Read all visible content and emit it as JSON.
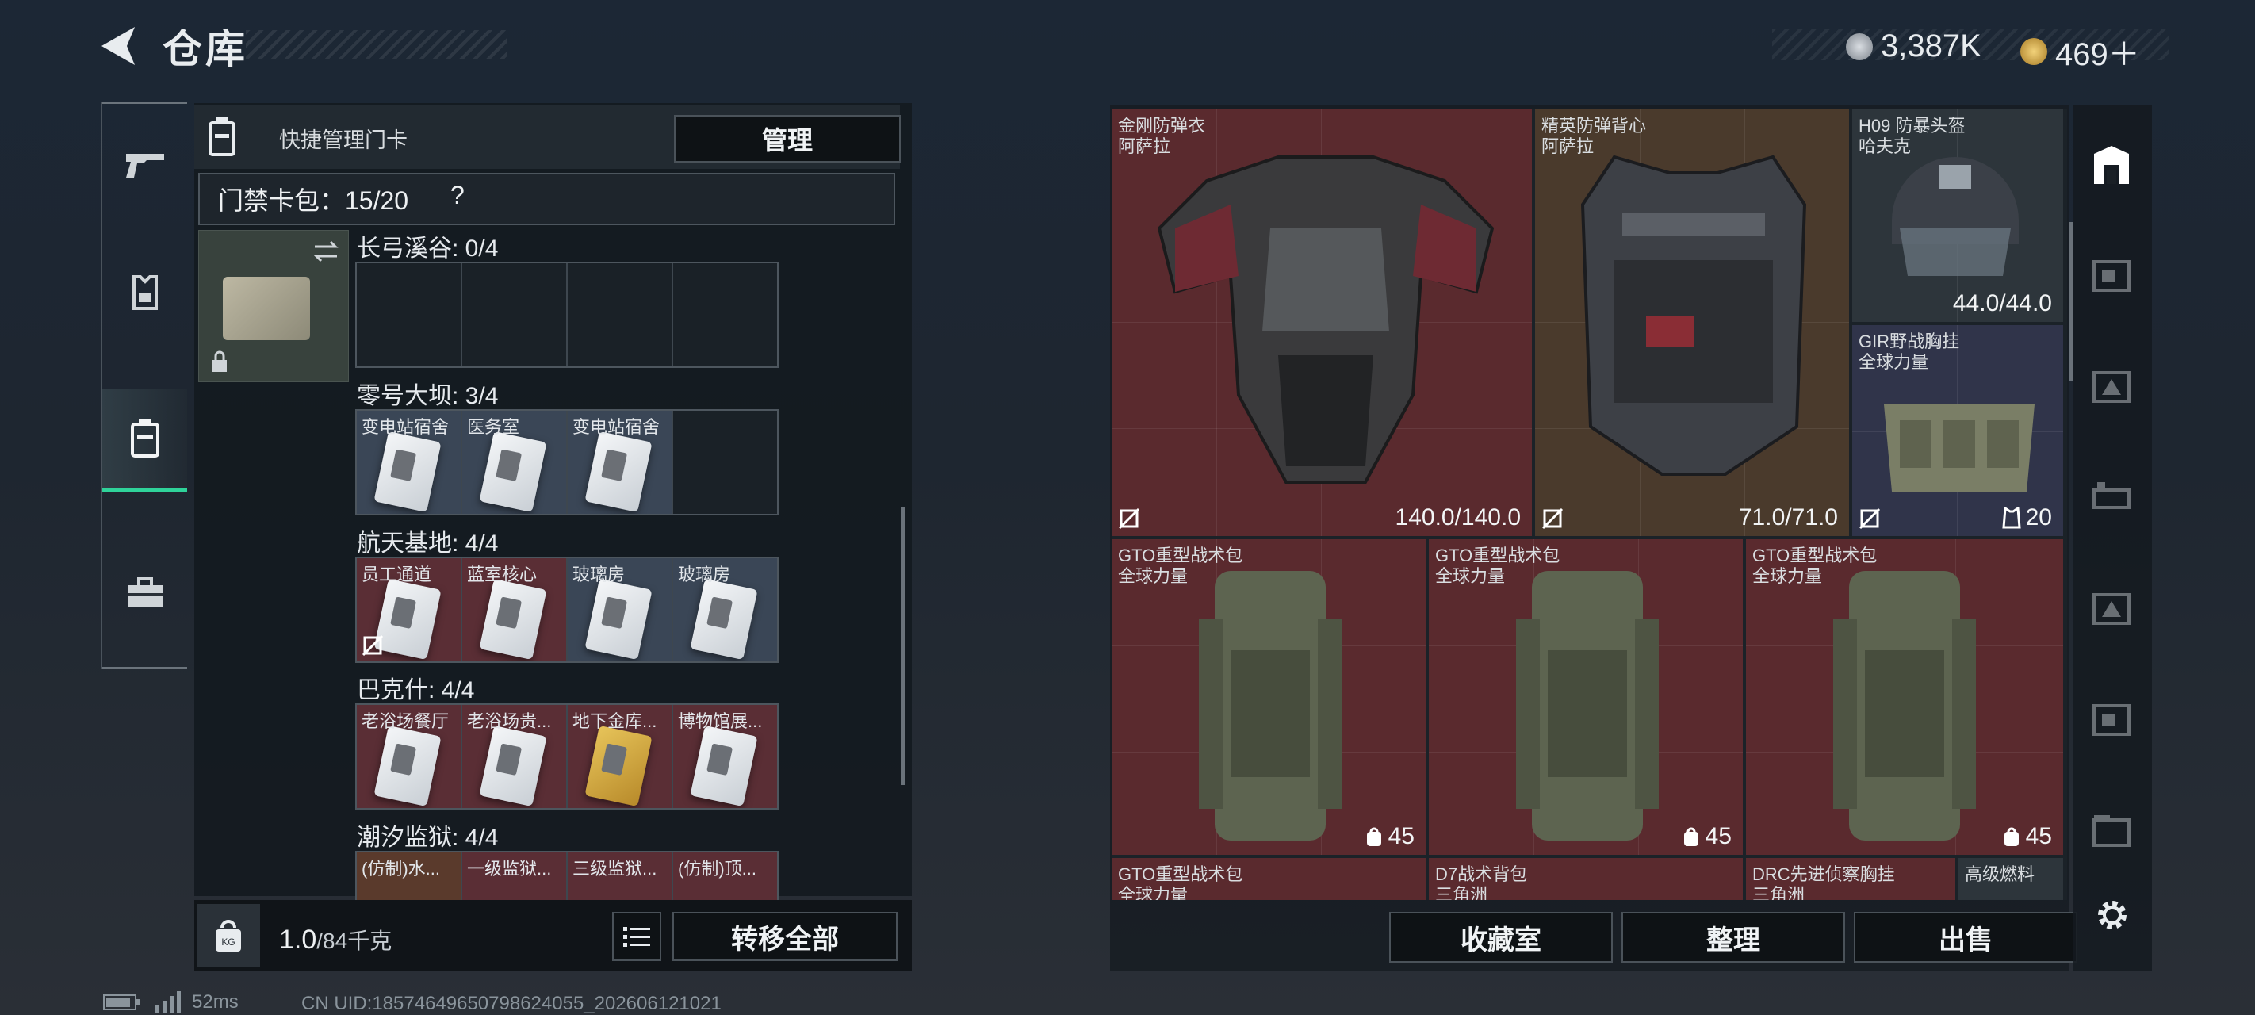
{
  "header": {
    "title": "仓库",
    "currency": [
      {
        "icon": "silver-coin-icon",
        "value": "3,387K"
      },
      {
        "icon": "gold-coin-icon",
        "value": "469＋"
      }
    ]
  },
  "left_nav": [
    "gun-icon",
    "armor-icon",
    "keycard-case-icon",
    "toolbox-icon"
  ],
  "keycard_panel": {
    "quick_manage_label": "快捷管理门卡",
    "manage_button": "管理",
    "pack_label": "门禁卡包：15/20",
    "help": "?",
    "sections": [
      {
        "title": "长弓溪谷: 0/4",
        "slots": [
          {
            "label": "",
            "filled": false
          },
          {
            "label": "",
            "filled": false
          },
          {
            "label": "",
            "filled": false
          },
          {
            "label": "",
            "filled": false
          }
        ]
      },
      {
        "title": "零号大坝: 3/4",
        "slots": [
          {
            "label": "变电站宿舍",
            "filled": true
          },
          {
            "label": "医务室",
            "filled": true
          },
          {
            "label": "变电站宿舍",
            "filled": true
          },
          {
            "label": "",
            "filled": false
          }
        ]
      },
      {
        "title": "航天基地: 4/4",
        "slots": [
          {
            "label": "员工通道",
            "filled": true
          },
          {
            "label": "蓝室核心",
            "filled": true
          },
          {
            "label": "玻璃房",
            "filled": true
          },
          {
            "label": "玻璃房",
            "filled": true
          }
        ]
      },
      {
        "title": "巴克什: 4/4",
        "slots": [
          {
            "label": "老浴场餐厅",
            "filled": true
          },
          {
            "label": "老浴场贵...",
            "filled": true
          },
          {
            "label": "地下金库...",
            "filled": true
          },
          {
            "label": "博物馆展...",
            "filled": true
          }
        ]
      },
      {
        "title": "潮汐监狱: 4/4",
        "slots": [
          {
            "label": "(仿制)水...",
            "filled": true
          },
          {
            "label": "一级监狱...",
            "filled": true
          },
          {
            "label": "三级监狱...",
            "filled": true
          },
          {
            "label": "(仿制)顶...",
            "filled": true
          }
        ]
      }
    ],
    "weight_value": "1.0",
    "weight_total": "/84千克",
    "transfer_all_button": "转移全部"
  },
  "inventory": {
    "items": [
      {
        "name": "金刚防弹衣",
        "sub": "阿萨拉",
        "value": "140.0/140.0",
        "icon": "no-insure-icon",
        "color": "red"
      },
      {
        "name": "精英防弹背心",
        "sub": "阿萨拉",
        "value": "71.0/71.0",
        "icon": "no-insure-icon",
        "color": "brown"
      },
      {
        "name": "H09 防暴头盔",
        "sub": "哈夫克",
        "value": "44.0/44.0",
        "icon": "",
        "color": "gray"
      },
      {
        "name": "GIR野战胸挂",
        "sub": "全球力量",
        "value": "20",
        "icon": "no-insure-icon",
        "color": "navy"
      },
      {
        "name": "GTO重型战术包",
        "sub": "全球力量",
        "value": "45",
        "icon": "",
        "color": "red"
      },
      {
        "name": "GTO重型战术包",
        "sub": "全球力量",
        "value": "45",
        "icon": "",
        "color": "red"
      },
      {
        "name": "GTO重型战术包",
        "sub": "全球力量",
        "value": "45",
        "icon": "",
        "color": "red"
      },
      {
        "name": "GTO重型战术包",
        "sub": "全球力量",
        "value": "",
        "icon": "",
        "color": "red"
      },
      {
        "name": "D7战术背包",
        "sub": "三角洲",
        "value": "",
        "icon": "",
        "color": "red"
      },
      {
        "name": "DRC先进侦察胸挂",
        "sub": "三角洲",
        "value": "",
        "icon": "",
        "color": "red"
      },
      {
        "name": "高级燃料",
        "sub": "",
        "value": "",
        "icon": "",
        "color": "gray"
      }
    ],
    "buttons": [
      "收藏室",
      "整理",
      "出售"
    ]
  },
  "footer": {
    "ping": "52ms",
    "uid": "CN UID:18574649650798624055_202606121021"
  }
}
